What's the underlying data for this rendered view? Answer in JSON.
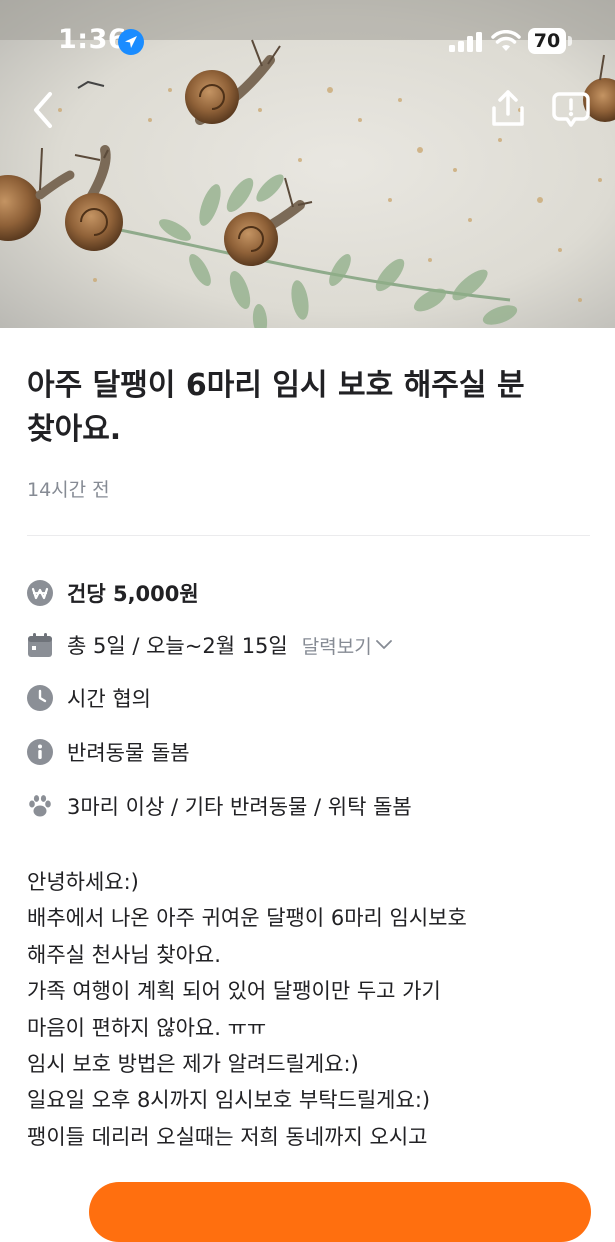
{
  "status_bar": {
    "time": "1:36",
    "battery": "70"
  },
  "icons": {
    "back": "chevron-left-icon",
    "share": "share-icon",
    "report": "report-icon",
    "location": "location-arrow-icon",
    "signal": "signal-icon",
    "wifi": "wifi-icon"
  },
  "post": {
    "title": "아주 달팽이 6마리 임시 보호 해주실 분 찾아요.",
    "time_ago": "14시간 전"
  },
  "info": {
    "price": "건당 5,000원",
    "schedule": "총 5일 / 오늘~2월 15일",
    "calendar_link": "달력보기",
    "time": "시간 협의",
    "category": "반려동물 돌봄",
    "pet_detail": "3마리 이상 / 기타 반려동물 / 위탁 돌봄"
  },
  "description_lines": [
    "안녕하세요:)",
    "배추에서 나온 아주 귀여운 달팽이 6마리 임시보호",
    "해주실 천사님 찾아요.",
    "가족 여행이 계획 되어 있어 달팽이만 두고 가기",
    "마음이 편하지 않아요. ㅠㅠ",
    "임시 보호 방법은 제가 알려드릴게요:)",
    "일요일 오후 8시까지 임시보호 부탁드릴게요:)",
    "팽이들 데리러 오실때는 저희 동네까지 오시고"
  ],
  "colors": {
    "accent": "#ff6f0f",
    "text_primary": "#212124",
    "text_secondary": "#868b94",
    "icon_gray": "#8b8f96"
  }
}
